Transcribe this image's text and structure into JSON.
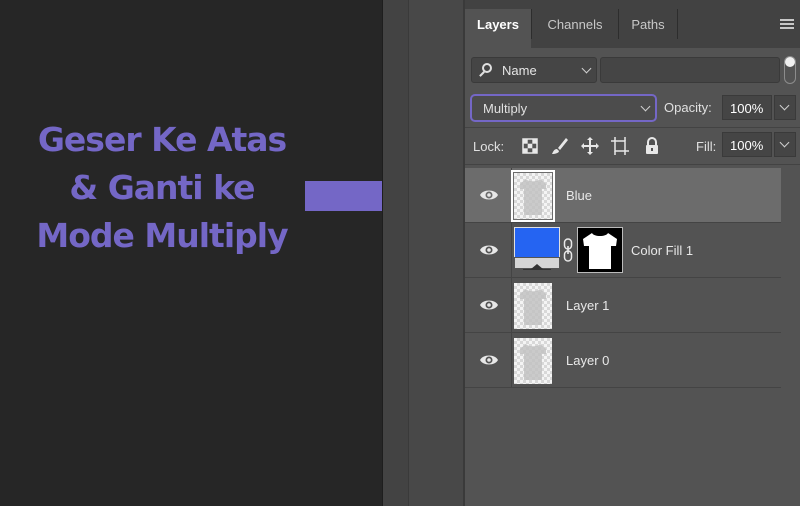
{
  "annotation": {
    "line1": "Geser Ke Atas",
    "line2": "& Ganti ke",
    "line3": "Mode Multiply",
    "color": "#7467c6"
  },
  "panel": {
    "tabs": [
      {
        "label": "Layers",
        "active": true
      },
      {
        "label": "Channels",
        "active": false
      },
      {
        "label": "Paths",
        "active": false
      }
    ],
    "menu_icon": "panel-menu-icon",
    "filter": {
      "kind_label": "Name",
      "search_value": ""
    },
    "blend_mode": "Multiply",
    "opacity_label": "Opacity:",
    "opacity_value": "100%",
    "lock_label": "Lock:",
    "fill_label": "Fill:",
    "fill_value": "100%",
    "layers": [
      {
        "name": "Blue",
        "selected": true,
        "visible": true
      },
      {
        "name": "Color Fill 1",
        "selected": false,
        "visible": true,
        "fill_color": "#2564f2"
      },
      {
        "name": "Layer 1",
        "selected": false,
        "visible": true
      },
      {
        "name": "Layer 0",
        "selected": false,
        "visible": true
      }
    ]
  }
}
